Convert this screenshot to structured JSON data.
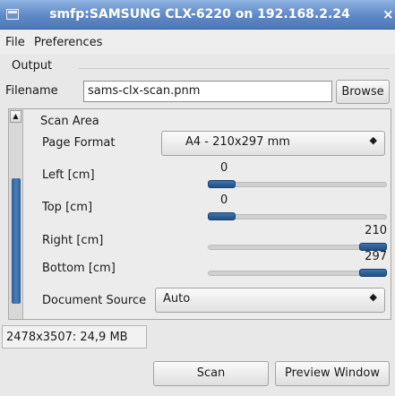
{
  "window": {
    "title": "smfp:SAMSUNG CLX-6220 on 192.168.2.24",
    "close_glyph": "×"
  },
  "menu": [
    {
      "label": "File"
    },
    {
      "label": "Preferences"
    }
  ],
  "output": {
    "frame_label": "Output",
    "filename_label": "Filename",
    "filename_value": "sams-clx-scan.pnm",
    "browse_label": "Browse"
  },
  "scan_area": {
    "section_label": "Scan Area",
    "page_format": {
      "label": "Page Format",
      "value": "A4 - 210x297 mm"
    },
    "left": {
      "label": "Left [cm]",
      "value": "0",
      "level": 0.0
    },
    "top": {
      "label": "Top [cm]",
      "value": "0",
      "level": 0.0
    },
    "right": {
      "label": "Right [cm]",
      "value": "210",
      "level": 1.0
    },
    "bottom": {
      "label": "Bottom [cm]",
      "value": "297",
      "level": 1.0
    },
    "document_source": {
      "label": "Document Source",
      "value": "Auto"
    }
  },
  "status": {
    "text": "2478x3507: 24,9 MB"
  },
  "actions": {
    "scan_label": "Scan",
    "preview_label": "Preview Window"
  },
  "icons": {
    "scroll_up": "triangle-up-icon",
    "combo_arrow": "updown-arrows-icon",
    "window_menu": "window-menu-icon"
  },
  "colors": {
    "titlebar": "#5f88c6",
    "slider_knob": "#2a5d97",
    "scroll_thumb": "#3d72aa"
  }
}
